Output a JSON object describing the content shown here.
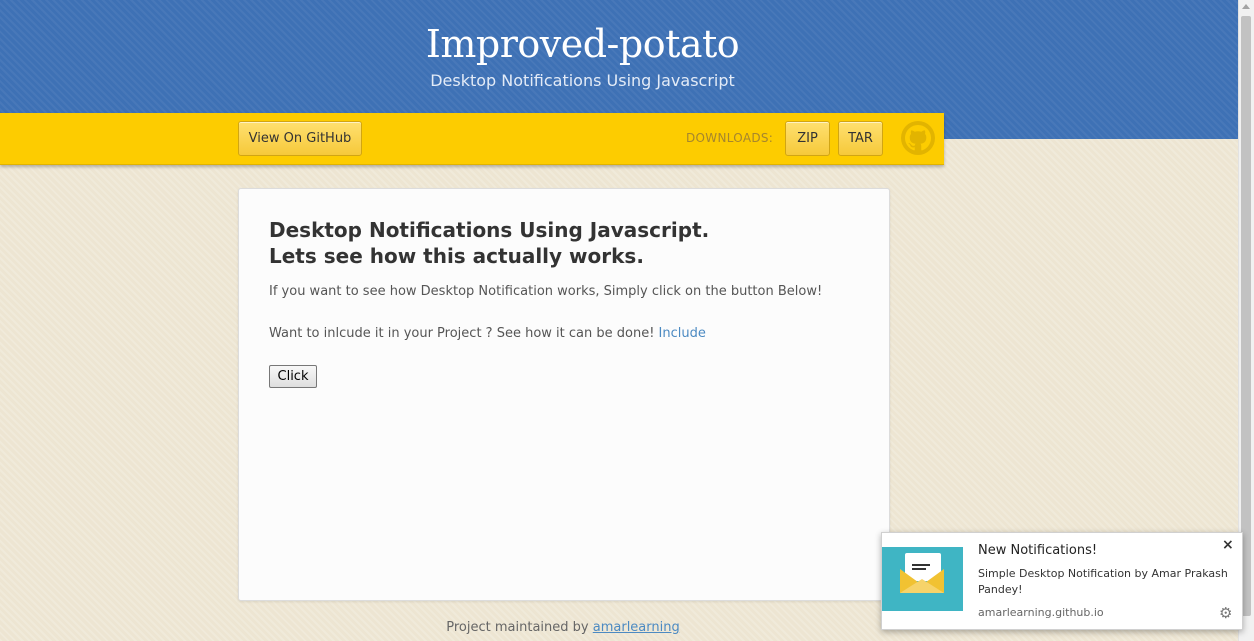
{
  "header": {
    "title": "Improved-potato",
    "subtitle": "Desktop Notifications Using Javascript"
  },
  "ribbon": {
    "github_button": "View On GitHub",
    "downloads_label": "DOWNLOADS:",
    "zip_button": "ZIP",
    "tar_button": "TAR",
    "logo_icon": "github-octocat-icon"
  },
  "main": {
    "heading_line1": "Desktop Notifications Using Javascript.",
    "heading_line2": "Lets see how this actually works.",
    "para1": "If you want to see how Desktop Notification works, Simply click on the button Below!",
    "para2_text": "Want to inlcude it in your Project ? See how it can be done!",
    "para2_link": "Include",
    "click_button": "Click"
  },
  "footer": {
    "text": "Project maintained by",
    "link": "amarlearning"
  },
  "notification": {
    "title": "New Notifications!",
    "body": "Simple Desktop Notification by Amar Prakash Pandey!",
    "origin": "amarlearning.github.io",
    "close_icon": "close-icon",
    "settings_icon": "gear-icon",
    "image_icon": "envelope-icon"
  },
  "colors": {
    "header_blue": "#3e71b5",
    "ribbon_yellow": "#fdcc00",
    "page_bg": "#ede5d2",
    "link_blue": "#4c8ac2",
    "notification_icon_bg": "#3fb5c4"
  }
}
